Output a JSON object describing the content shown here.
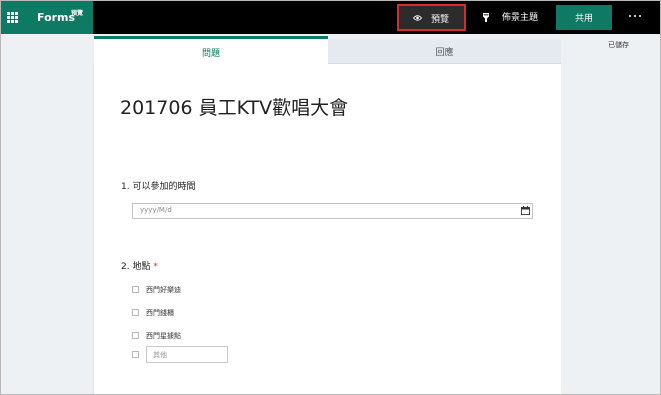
{
  "app": {
    "name": "Forms",
    "tag": "預覽"
  },
  "toolbar": {
    "preview_label": "預覽",
    "theme_label": "佈景主題",
    "share_label": "共用",
    "saved_status": "已儲存"
  },
  "tabs": [
    {
      "label": "問題",
      "active": true
    },
    {
      "label": "回應",
      "active": false
    }
  ],
  "form": {
    "title": "201706 員工KTV歡唱大會",
    "questions": [
      {
        "label": "1. 可以參加的時間",
        "input_placeholder": "yyyy/M/d"
      },
      {
        "label": "2. 地點",
        "required_mark": "*",
        "options": [
          "西門好樂迪",
          "西門錢櫃",
          "西門星據點"
        ],
        "other_placeholder": "其他"
      }
    ]
  },
  "colors": {
    "brand": "#0f7a64",
    "topbar": "#000000",
    "highlight": "#d92b2b",
    "required": "#c0392b"
  },
  "icons": [
    "waffle-icon",
    "eye-icon",
    "lightbulb-icon",
    "more-icon",
    "calendar-icon"
  ]
}
